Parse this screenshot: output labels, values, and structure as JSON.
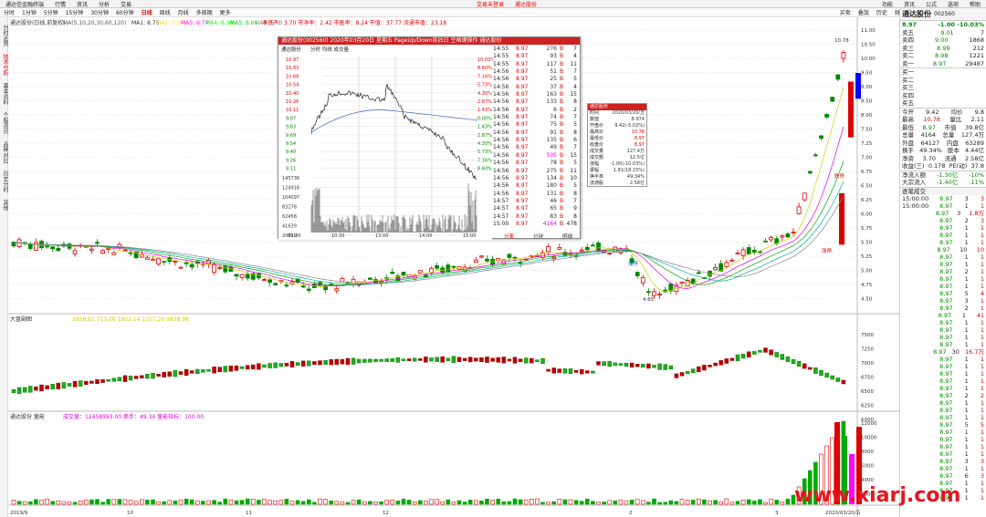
{
  "menubar": {
    "app": "通达信金融终端",
    "items": [
      "行情",
      "资讯",
      "分析",
      "交易"
    ],
    "center": "交易未登录",
    "stock": "通达股份",
    "right": [
      "功能",
      "资讯",
      "公式",
      "选项",
      "帮助"
    ]
  },
  "tabbar": {
    "tabs": [
      "分时",
      "1分钟",
      "5分钟",
      "15分钟",
      "30分钟",
      "60分钟",
      "日线",
      "周线",
      "月线",
      "多周期",
      "更多"
    ],
    "active": "日线",
    "tools": [
      "买卖",
      "叠加",
      "历史",
      "财务",
      "F10",
      "标记",
      "+自选",
      "画线"
    ]
  },
  "leftbar": [
    "分时走势",
    "技术分析",
    "基本资料",
    "个股资讯",
    "品种对比",
    "历史分时",
    "其他"
  ],
  "main_header": {
    "name": "通达股份(日线,前复权)",
    "ma_label": "MA(5,10,20,30,60,120)",
    "mas": [
      {
        "k": "MA1",
        "v": "8.75",
        "c": "#ffffff"
      },
      {
        "k": "MA2",
        "v": "7.57",
        "c": "#ffcc00"
      },
      {
        "k": "MA3",
        "v": "6.77",
        "c": "#ff00ff"
      },
      {
        "k": "MA4",
        "v": "6.30",
        "c": "#00ff00"
      },
      {
        "k": "MA5",
        "v": "6.01",
        "c": "#00cc00"
      },
      {
        "k": "MA6",
        "v": "5.60",
        "c": "#888888"
      }
    ],
    "extra": "净资产：3.70 市净率：2.42 市盈率：8.24 市值：37.77 流通市值：23.18"
  },
  "price_axis": [
    "11.00",
    "10.50",
    "10.00",
    "9.50",
    "9.00",
    "8.50",
    "8.00",
    "7.50",
    "7.25",
    "7.00",
    "6.75",
    "6.50",
    "6.25",
    "6.00",
    "5.75",
    "5.50",
    "5.25",
    "5.00",
    "4.75",
    "4.50"
  ],
  "annotations": {
    "high": "10.78",
    "low": "4.65",
    "mark1": "涨停",
    "mark2": "跌停",
    "mark3": "涨停"
  },
  "index_panel": {
    "title": "大盘副图",
    "vals": "2856.81 713.00 1922.14 1107.20 3838.98",
    "axis": [
      "7500",
      "7250",
      "7000",
      "6750",
      "6500",
      "6250",
      "6000"
    ]
  },
  "vol_panel": {
    "title": "通达股份 量能",
    "vals": "成交量：12458993.00 换手：49.34 量能指标：100.00",
    "axis": [
      "12000",
      "10000",
      "8000",
      "6000",
      "4000",
      "2000"
    ]
  },
  "date_axis": [
    "2019/9",
    "10",
    "11",
    "12",
    "2",
    "3",
    "2020/03/20/五"
  ],
  "popup": {
    "title": "通达股份(002560) 2020年03月20日 星期五 PageUp/Down前后日 空格键操作 通达股份",
    "subtitle": "分时  均线  成交量",
    "prices": [
      "10.97",
      "10.83",
      "10.68",
      "10.54",
      "10.40",
      "10.26",
      "10.11",
      "9.97",
      "9.83",
      "9.69",
      "9.54",
      "9.40",
      "9.26",
      "9.11",
      "9.97"
    ],
    "pcts": [
      "10.03%",
      "8.60%",
      "7.16%",
      "5.73%",
      "4.30%",
      "2.87%",
      "1.43%",
      "0.00%",
      "1.43%",
      "2.87%",
      "4.30%",
      "5.73%",
      "7.16%",
      "8.60%"
    ],
    "vols": [
      "145736",
      "124916",
      "104097",
      "83278",
      "62458",
      "41639",
      "20819"
    ],
    "times": [
      "09:30",
      "10:30",
      "13:00",
      "14:00",
      "15:00"
    ],
    "bottom": [
      "分笔",
      "分钟",
      "明细"
    ],
    "ticks": [
      [
        "14:55",
        "8.97",
        "276",
        "B",
        "7"
      ],
      [
        "14:55",
        "8.97",
        "93",
        "B",
        "4"
      ],
      [
        "14:55",
        "8.97",
        "117",
        "B",
        "11"
      ],
      [
        "14:56",
        "8.97",
        "51",
        "B",
        "7"
      ],
      [
        "14:56",
        "8.97",
        "25",
        "B",
        "5"
      ],
      [
        "14:56",
        "8.97",
        "37",
        "B",
        "4"
      ],
      [
        "14:56",
        "8.97",
        "163",
        "B",
        "15"
      ],
      [
        "14:56",
        "8.97",
        "133",
        "B",
        "8"
      ],
      [
        "14:56",
        "8.97",
        "6",
        "B",
        "2"
      ],
      [
        "14:56",
        "8.97",
        "74",
        "B",
        "7"
      ],
      [
        "14:56",
        "8.97",
        "75",
        "B",
        "5"
      ],
      [
        "14:56",
        "8.97",
        "91",
        "B",
        "8"
      ],
      [
        "14:56",
        "8.97",
        "135",
        "B",
        "6"
      ],
      [
        "14:56",
        "8.97",
        "49",
        "B",
        "7"
      ],
      [
        "14:56",
        "8.97",
        "505",
        "B",
        "15"
      ],
      [
        "14:56",
        "8.97",
        "78",
        "B",
        "5"
      ],
      [
        "14:56",
        "8.97",
        "275",
        "B",
        "11"
      ],
      [
        "14:56",
        "8.97",
        "134",
        "B",
        "10"
      ],
      [
        "14:56",
        "8.97",
        "180",
        "B",
        "5"
      ],
      [
        "14:56",
        "8.97",
        "131",
        "B",
        "8"
      ],
      [
        "14:57",
        "8.97",
        "46",
        "B",
        "7"
      ],
      [
        "14:57",
        "8.97",
        "65",
        "B",
        "9"
      ],
      [
        "14:57",
        "8.97",
        "83",
        "B",
        "8"
      ],
      [
        "15:00",
        "8.97",
        "4164",
        "B",
        "478"
      ]
    ]
  },
  "infobox": {
    "title": "通达股份",
    "rows": [
      [
        "时间",
        "2020/03/20/五"
      ],
      [
        "数值",
        "8.974"
      ],
      [
        "开盘价",
        "9.42(-5.02%)"
      ],
      [
        "最高价",
        "10.78"
      ],
      [
        "最低价",
        "8.97"
      ],
      [
        "收盘价",
        "8.97"
      ],
      [
        "成交量",
        "127.4万"
      ],
      [
        "成交额",
        "12.5亿"
      ],
      [
        "涨幅",
        "-1.00(-10.03%)"
      ],
      [
        "振幅",
        "1.81(18.15%)"
      ],
      [
        "换手率",
        "49.34%"
      ],
      [
        "流通股",
        "2.58亿"
      ]
    ]
  },
  "right": {
    "name": "通达股份",
    "code": "002560",
    "price": "8.97",
    "chg": "-1.00",
    "pct": "-10.03%",
    "asks": [
      [
        "卖五",
        "9.01",
        "7"
      ],
      [
        "卖四",
        "9.00",
        "1868"
      ],
      [
        "卖三",
        "8.99",
        "212"
      ],
      [
        "卖二",
        "8.98",
        "1221"
      ],
      [
        "卖一",
        "8.97",
        "29487"
      ]
    ],
    "bids": [
      [
        "买一",
        "",
        ""
      ],
      [
        "买二",
        "",
        ""
      ],
      [
        "买三",
        "",
        ""
      ],
      [
        "买四",
        "",
        ""
      ],
      [
        "买五",
        "",
        ""
      ]
    ],
    "stats": [
      [
        "今开",
        "9.42",
        "均价",
        "9.8"
      ],
      [
        "最高",
        "10.78",
        "量比",
        "2.11"
      ],
      [
        "最低",
        "8.97",
        "市值",
        "39.8亿"
      ],
      [
        "总量",
        "4164",
        "总量",
        "127.4万"
      ],
      [
        "外盘",
        "64127",
        "内盘",
        "63289"
      ],
      [
        "换手",
        "49.34%",
        "股本",
        "4.44亿"
      ],
      [
        "净资",
        "3.70",
        "流通",
        "2.58亿"
      ],
      [
        "收益(三)",
        "0.178",
        "PE(动)",
        "37.8"
      ]
    ],
    "flow": [
      [
        "净流入额",
        "-1.30亿",
        "-10%"
      ],
      [
        "大宗流入",
        "-1.40亿",
        "-11%"
      ]
    ],
    "flow_title": "逐笔成交",
    "trades": [
      [
        "15:00:00",
        "8.97",
        "3",
        "3"
      ],
      [
        "15:00:00",
        "8.97",
        "1",
        "1"
      ],
      [
        "",
        "8.97",
        "3",
        "1.8万"
      ],
      [
        "",
        "8.97",
        "2",
        "3"
      ],
      [
        "",
        "8.97",
        "1",
        "1"
      ],
      [
        "",
        "8.97",
        "1",
        "1"
      ],
      [
        "",
        "8.97",
        "1",
        "1"
      ],
      [
        "",
        "8.97",
        "10",
        "10"
      ],
      [
        "",
        "8.97",
        "1",
        "1"
      ],
      [
        "",
        "8.97",
        "1",
        "1"
      ],
      [
        "",
        "8.97",
        "2",
        "1"
      ],
      [
        "",
        "8.97",
        "1",
        "1"
      ],
      [
        "",
        "8.97",
        "1",
        "1"
      ],
      [
        "",
        "8.97",
        "5",
        "4"
      ],
      [
        "",
        "8.97",
        "3",
        "1"
      ],
      [
        "",
        "8.97",
        "2",
        "1"
      ],
      [
        "",
        "8.97",
        "1",
        "41"
      ],
      [
        "",
        "8.97",
        "1",
        "1"
      ],
      [
        "",
        "8.97",
        "1",
        "1"
      ],
      [
        "",
        "8.97",
        "1",
        "1"
      ],
      [
        "",
        "8.97",
        "1",
        "1"
      ],
      [
        "",
        "8.97",
        "30",
        "16.7万"
      ],
      [
        "",
        "8.97",
        "1",
        "1"
      ],
      [
        "",
        "8.97",
        "1",
        "1"
      ],
      [
        "",
        "8.97",
        "1",
        "1"
      ],
      [
        "",
        "8.97",
        "1",
        "1"
      ],
      [
        "",
        "8.97",
        "1",
        "1"
      ],
      [
        "",
        "8.97",
        "2",
        "2"
      ],
      [
        "",
        "8.97",
        "1",
        "1"
      ],
      [
        "",
        "8.97",
        "1",
        "1"
      ],
      [
        "",
        "8.97",
        "1",
        "1"
      ],
      [
        "",
        "8.97",
        "5",
        "5"
      ],
      [
        "",
        "8.97",
        "1",
        "1"
      ],
      [
        "",
        "8.97",
        "1",
        "1"
      ],
      [
        "",
        "8.97",
        "1",
        "1"
      ],
      [
        "",
        "8.97",
        "1",
        "1"
      ],
      [
        "",
        "8.97",
        "3",
        "3"
      ],
      [
        "",
        "8.97",
        "1",
        "1"
      ],
      [
        "",
        "8.97",
        "6",
        "3"
      ],
      [
        "",
        "8.97",
        "1",
        "1"
      ],
      [
        "",
        "8.97",
        "1",
        "1"
      ],
      [
        "",
        "8.97",
        "1",
        "1"
      ]
    ]
  },
  "watermark": "www.xiarj.com"
}
